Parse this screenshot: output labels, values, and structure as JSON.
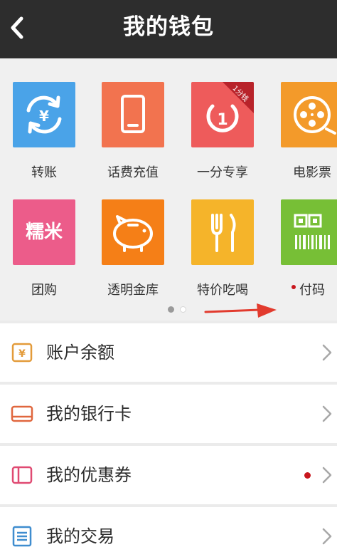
{
  "header": {
    "title": "我的钱包",
    "back_icon": "chevron-left-icon"
  },
  "tiles": [
    {
      "label": "转账",
      "color": "#4aa3e8",
      "icon": "yuan-transfer-icon"
    },
    {
      "label": "话费充值",
      "color": "#f2734f",
      "icon": "phone-icon"
    },
    {
      "label": "一分专享",
      "color": "#ee5b5b",
      "icon": "one-cent-icon",
      "badge": "1分钱"
    },
    {
      "label": "电影票",
      "color": "#f39a2a",
      "icon": "film-reel-icon"
    },
    {
      "label": "团购",
      "color": "#ec5c8a",
      "icon": "nuomi-icon",
      "icon_text": "糯米"
    },
    {
      "label": "透明金库",
      "color": "#f57f17",
      "icon": "piggy-bank-icon"
    },
    {
      "label": "特价吃喝",
      "color": "#f5b42a",
      "icon": "fork-knife-icon"
    },
    {
      "label": "付码",
      "color": "#77bf36",
      "icon": "qr-barcode-icon"
    }
  ],
  "pager": {
    "pages": 2,
    "current": 1,
    "active_color": "#9a9a9a",
    "inactive_color": "#ffffff"
  },
  "menu": [
    {
      "label": "账户余额",
      "icon": "wallet-icon",
      "icon_color": "#e39b3a",
      "has_dot": false
    },
    {
      "label": "我的银行卡",
      "icon": "bank-card-icon",
      "icon_color": "#e0673e",
      "has_dot": false
    },
    {
      "label": "我的优惠券",
      "icon": "coupon-icon",
      "icon_color": "#e04a72",
      "has_dot": true
    },
    {
      "label": "我的交易",
      "icon": "transaction-list-icon",
      "icon_color": "#3f8dcf",
      "has_dot": false
    }
  ],
  "colors": {
    "header_bg": "#2d2d2d",
    "accent_red": "#c8161d"
  }
}
